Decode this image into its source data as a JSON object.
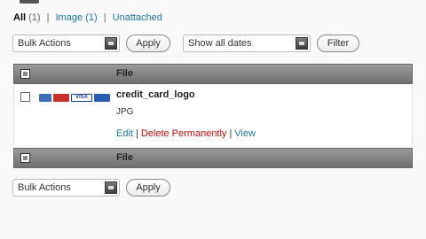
{
  "filters": {
    "all_label": "All",
    "all_count": "(1)",
    "image_label": "Image",
    "image_count": "(1)",
    "unattached_label": "Unattached",
    "separator": "|"
  },
  "top_actions": {
    "bulk_select": "Bulk Actions",
    "apply": "Apply",
    "dates_select": "Show all dates",
    "filter": "Filter"
  },
  "table": {
    "header_file": "File",
    "footer_file": "File",
    "rows": [
      {
        "name": "credit_card_logo",
        "type": "JPG",
        "thumb_text": "VISA",
        "edit": "Edit",
        "delete": "Delete Permanently",
        "view": "View"
      }
    ]
  },
  "bottom_actions": {
    "bulk_select": "Bulk Actions",
    "apply": "Apply"
  },
  "colors": {
    "link": "#21759b",
    "delete_link": "#bc0b0b",
    "header_bg": "#8a8a8a"
  }
}
